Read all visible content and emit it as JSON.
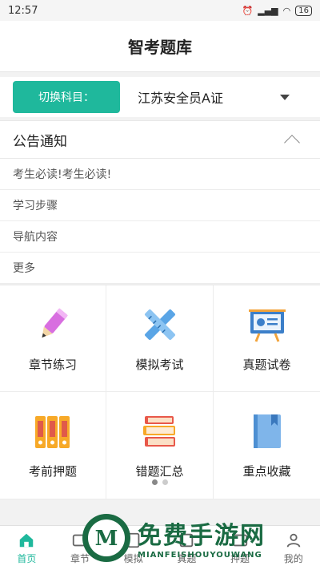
{
  "status_bar": {
    "time": "12:57",
    "battery": "16"
  },
  "header": {
    "title": "智考题库"
  },
  "subject": {
    "button_label": "切换科目：",
    "current": "江苏安全员A证"
  },
  "notice": {
    "title": "公告通知",
    "items": [
      "考生必读!考生必读!",
      "学习步骤",
      "导航内容",
      "更多"
    ]
  },
  "grid": [
    {
      "label": "章节练习",
      "icon": "pencil-icon"
    },
    {
      "label": "模拟考试",
      "icon": "ruler-pencil-icon"
    },
    {
      "label": "真题试卷",
      "icon": "presentation-board-icon"
    },
    {
      "label": "考前押题",
      "icon": "binders-icon"
    },
    {
      "label": "错题汇总",
      "icon": "books-stack-icon"
    },
    {
      "label": "重点收藏",
      "icon": "bookmark-book-icon"
    }
  ],
  "tabs": [
    {
      "label": "首页",
      "icon": "home-icon",
      "active": true
    },
    {
      "label": "章节",
      "icon": "chapter-icon"
    },
    {
      "label": "模拟",
      "icon": "mock-exam-icon"
    },
    {
      "label": "真题",
      "icon": "past-paper-icon"
    },
    {
      "label": "押题",
      "icon": "predict-icon"
    },
    {
      "label": "我的",
      "icon": "profile-icon"
    }
  ],
  "watermark": {
    "cn": "免费手游网",
    "en": "MIANFEISHOUYOUWANG"
  },
  "colors": {
    "accent": "#1fb89c"
  }
}
